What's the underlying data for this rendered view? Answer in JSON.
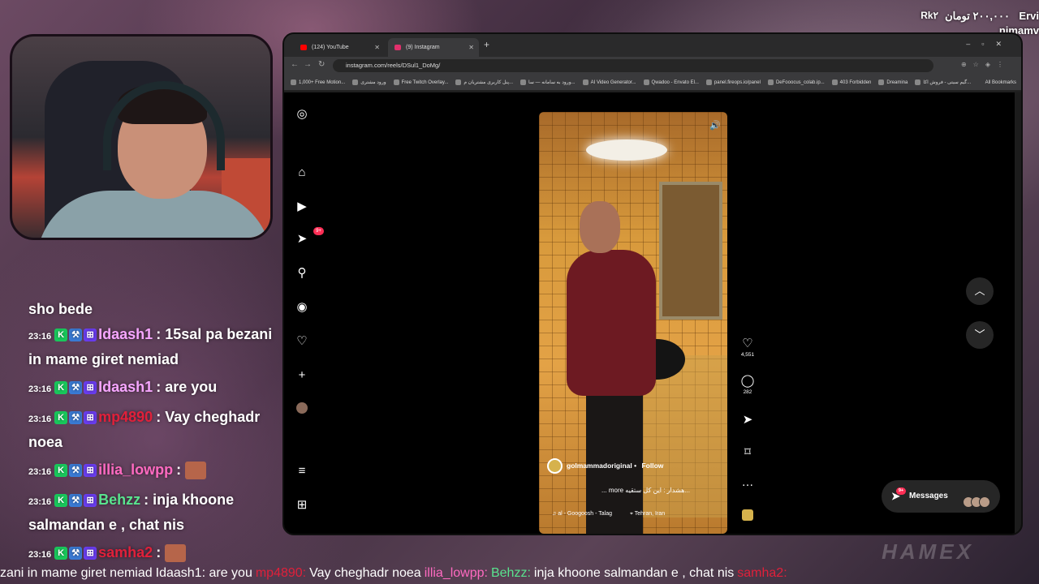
{
  "stream": {
    "donation": {
      "user": "Rk۲",
      "amount": "۲۰۰,۰۰۰ تومان",
      "name1": "Ervi",
      "name2": "nimamv"
    },
    "chat": {
      "truncated_top": "sho bede",
      "messages": [
        {
          "time": "23:16",
          "user": "Idaash1",
          "user_color": "#f6a6ff",
          "text": "15sal pa bezani in mame giret nemiad"
        },
        {
          "time": "23:16",
          "user": "Idaash1",
          "user_color": "#f6a6ff",
          "text": "are you"
        },
        {
          "time": "23:16",
          "user": "mp4890",
          "user_color": "#e0203a",
          "text": "Vay cheghadr noea"
        },
        {
          "time": "23:16",
          "user": "illia_lowpp",
          "user_color": "#ff6ac1",
          "text": ""
        },
        {
          "time": "23:16",
          "user": "Behzz",
          "user_color": "#59e38e",
          "text": "inja khoone salmandan e , chat nis"
        },
        {
          "time": "23:16",
          "user": "samha2",
          "user_color": "#e0203a",
          "text": ""
        }
      ]
    },
    "ticker": {
      "segments": [
        {
          "text": "zani in mame giret nemiad",
          "color": "#ffffff"
        },
        {
          "text": "Idaash1: are you",
          "color": "#ffffff"
        },
        {
          "text": "mp4890:",
          "color": "#e0203a"
        },
        {
          "text": "Vay cheghadr noea",
          "color": "#ffffff"
        },
        {
          "text": "illia_lowpp:",
          "color": "#ff6ac1"
        },
        {
          "text": "Behzz:",
          "color": "#59e38e"
        },
        {
          "text": "inja khoone salmandan e , chat nis",
          "color": "#ffffff"
        },
        {
          "text": "samha2:",
          "color": "#e0203a"
        }
      ],
      "watermark": "HAMEX"
    }
  },
  "browser": {
    "tabs": [
      {
        "label": "(124) YouTube",
        "icon_color": "#ff0000"
      },
      {
        "label": "(9) Instagram",
        "icon_color": "#e1306c"
      }
    ],
    "url": "instagram.com/reels/DSul1_DoMg/",
    "bookmarks": [
      "1,000+ Free Motion...",
      "ورود مشتری",
      "Free Twitch Overlay...",
      "پنل کاربری مشتریان م...",
      "ورود به سامانه — سا...",
      "AI Video Generator...",
      "Qwadoo - Envato El...",
      "panel.fireops.io/panel",
      "DeFooocus_colab.ip...",
      "403 Forbidden",
      "Dreamina",
      "گیم سیتی - فروش اکا..."
    ],
    "all_bookmarks": "All Bookmarks"
  },
  "instagram": {
    "notifications_badge": "9+",
    "reel": {
      "author": "golmammadoriginal",
      "follow": "Follow",
      "caption": "هشدار : این کل ستقیه...",
      "more": "... more",
      "audio": "al - Googoosh - Talag",
      "location": "Tehran, Iran"
    },
    "likes": "4,551",
    "comments": "282",
    "messages": {
      "label": "Messages",
      "badge": "9+"
    }
  }
}
